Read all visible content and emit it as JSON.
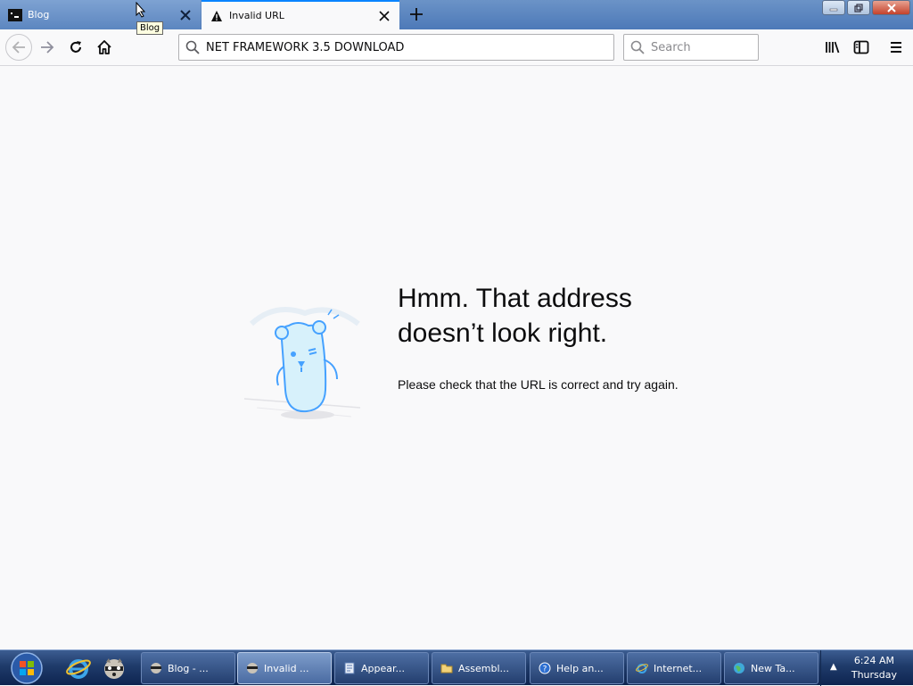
{
  "tabs": [
    {
      "title": "Blog",
      "favicon": "blog-favicon",
      "active": false
    },
    {
      "title": "Invalid URL",
      "favicon": "warning-icon",
      "active": true
    }
  ],
  "tooltip": "Blog",
  "urlbar": {
    "value": "NET FRAMEWORK 3.5 DOWNLOAD"
  },
  "search": {
    "placeholder": "Search"
  },
  "error": {
    "title_line1": "Hmm. That address",
    "title_line2": "doesn’t look right.",
    "description": "Please check that the URL is correct and try again."
  },
  "taskbar": {
    "items": [
      {
        "label": "Blog - ...",
        "icon": "raccoon-icon",
        "active": false
      },
      {
        "label": "Invalid ...",
        "icon": "raccoon-icon",
        "active": true
      },
      {
        "label": "Appear...",
        "icon": "document-icon",
        "active": false
      },
      {
        "label": "Assembl...",
        "icon": "folder-icon",
        "active": false
      },
      {
        "label": "Help an...",
        "icon": "help-icon",
        "active": false
      },
      {
        "label": "Internet...",
        "icon": "ie-icon",
        "active": false
      },
      {
        "label": "New Ta...",
        "icon": "globe-icon",
        "active": false
      }
    ],
    "clock_time": "6:24 AM",
    "clock_day": "Thursday"
  },
  "colors": {
    "accent": "#0a84ff",
    "taskbar": "#1f3b6a",
    "page_bg": "#f9f9fa"
  }
}
